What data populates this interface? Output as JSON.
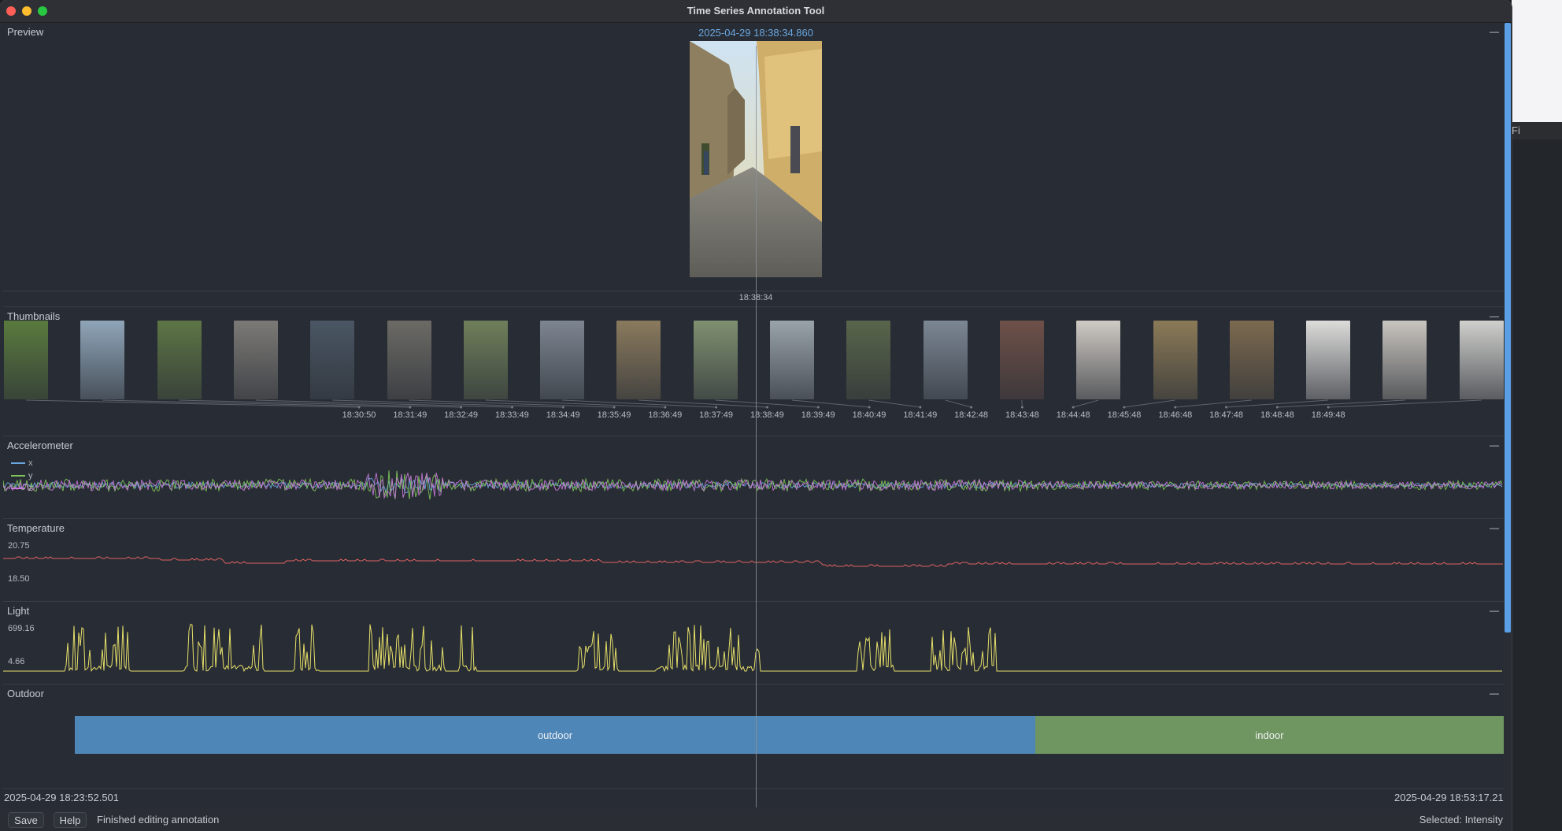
{
  "window": {
    "title": "Time Series Annotation Tool"
  },
  "preview": {
    "label": "Preview",
    "timestamp": "2025-04-29 18:38:34.860",
    "time_label": "18:38:34"
  },
  "thumbnails": {
    "label": "Thumbnails",
    "ticks": [
      "18:30:50",
      "18:31:49",
      "18:32:49",
      "18:33:49",
      "18:34:49",
      "18:35:49",
      "18:36:49",
      "18:37:49",
      "18:38:49",
      "18:39:49",
      "18:40:49",
      "18:41:49",
      "18:42:48",
      "18:43:48",
      "18:44:48",
      "18:45:48",
      "18:46:48",
      "18:47:48",
      "18:48:48",
      "18:49:48"
    ],
    "image_colors": [
      "#5a7a3e",
      "#8fa5b8",
      "#5d7545",
      "#7c7a76",
      "#4a5663",
      "#6b6a65",
      "#6f7f5a",
      "#7d8590",
      "#8a7a5d",
      "#7f9070",
      "#9aa3aa",
      "#59654b",
      "#7c8794",
      "#6e5048",
      "#cfcac4",
      "#8b7a57",
      "#7c6a4f",
      "#dcdcda",
      "#c9c5bf",
      "#cfcfcc"
    ]
  },
  "accelerometer": {
    "label": "Accelerometer",
    "legend": [
      "x",
      "y",
      "z"
    ],
    "colors": {
      "x": "#6aa7e0",
      "y": "#7ec45a",
      "z": "#c77ad8"
    }
  },
  "temperature": {
    "label": "Temperature",
    "max": "20.75",
    "min": "18.50",
    "color": "#e06262"
  },
  "light": {
    "label": "Light",
    "max": "699.16",
    "min": "4.66",
    "color": "#e6e06a"
  },
  "outdoor": {
    "label": "Outdoor",
    "segments": [
      {
        "label": "outdoor",
        "color": "#4f86b8"
      },
      {
        "label": "indoor",
        "color": "#6f9561"
      }
    ]
  },
  "range": {
    "start": "2025-04-29 18:23:52.501",
    "end": "2025-04-29 18:53:17.219"
  },
  "status": {
    "save_label": "Save",
    "help_label": "Help",
    "message": "Finished editing annotation",
    "selected": "Selected: Intensity"
  },
  "collapse_glyph": "—",
  "menubar_glyph": " Fi"
}
